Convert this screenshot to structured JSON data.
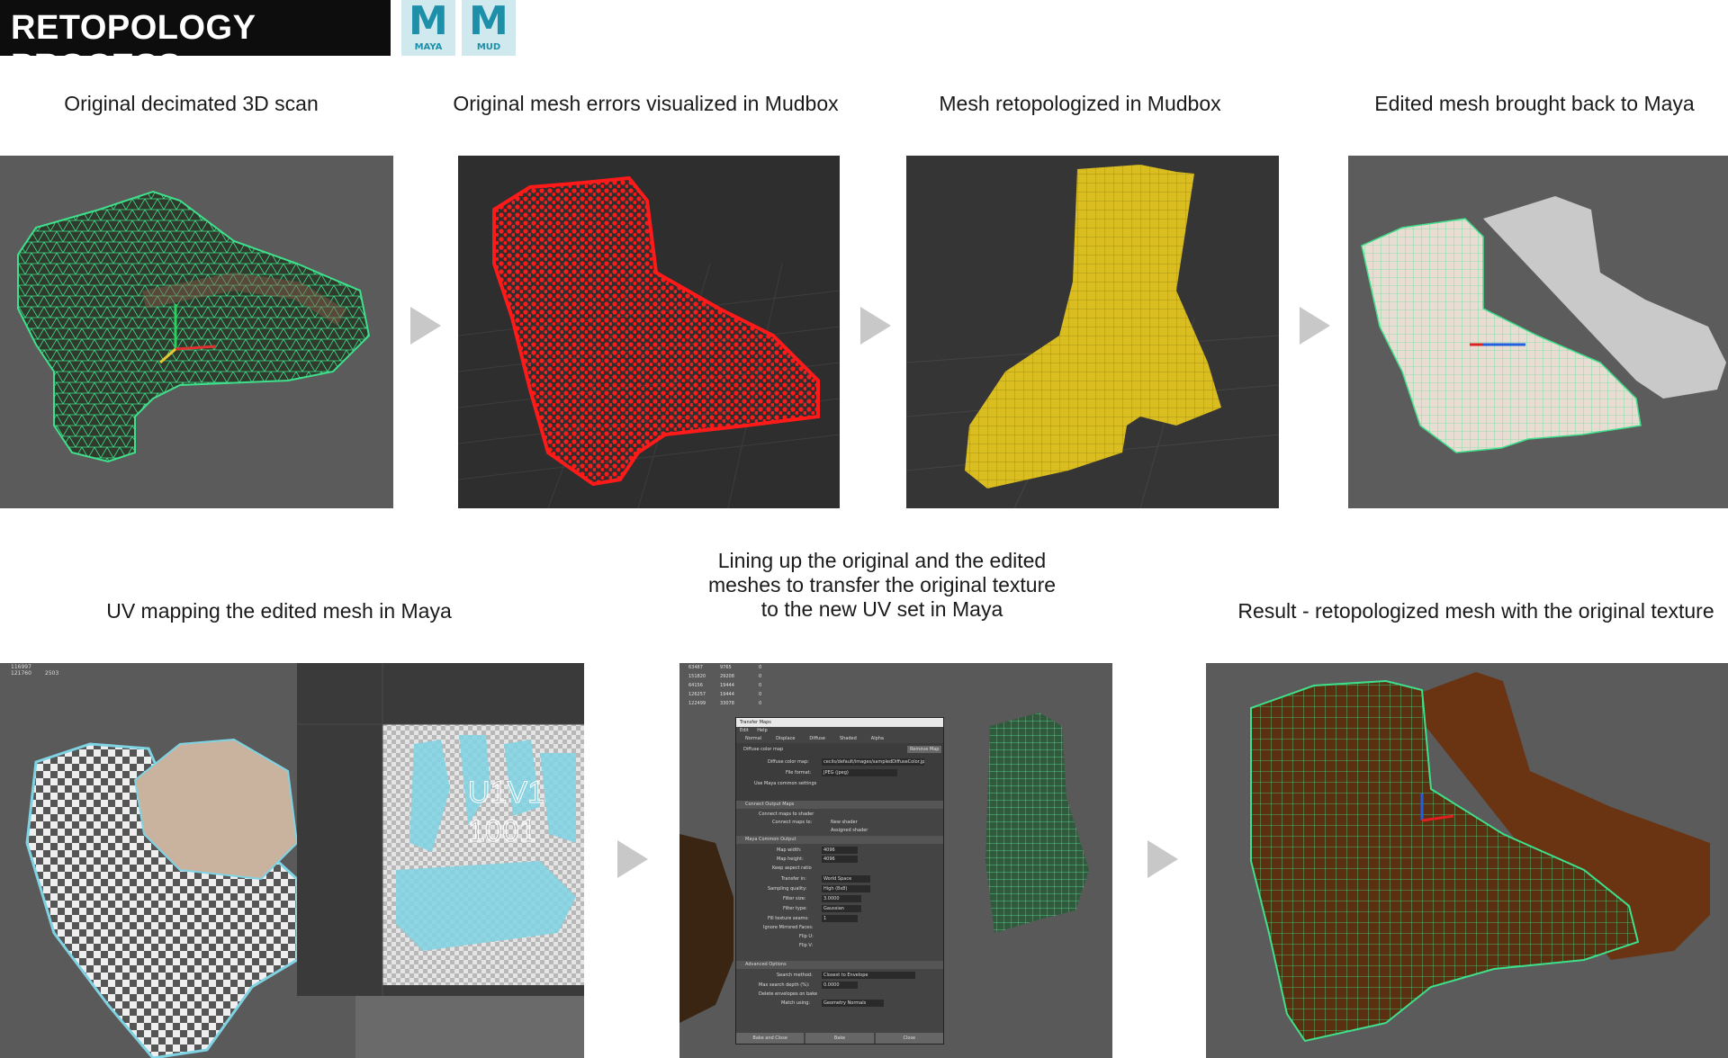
{
  "header": {
    "title": "RETOPOLOGY PROCESS",
    "logos": [
      {
        "icon": "maya-logo-icon",
        "label": "MAYA",
        "color": "#1e8fa8"
      },
      {
        "icon": "mudbox-logo-icon",
        "label": "MUD",
        "color": "#1e8fa8"
      }
    ]
  },
  "steps": [
    {
      "caption": "Original decimated 3D scan"
    },
    {
      "caption": "Original mesh errors visualized in Mudbox"
    },
    {
      "caption": "Mesh retopologized in Mudbox"
    },
    {
      "caption": "Edited mesh brought back to Maya"
    },
    {
      "caption": "UV mapping the edited mesh in Maya"
    },
    {
      "caption_lines": [
        "Lining up the original and the edited",
        "meshes to transfer the original texture",
        "to the new UV set in Maya"
      ]
    },
    {
      "caption": "Result - retopologized mesh with the original texture"
    }
  ],
  "uv_editor": {
    "tile_label_1": "U1V1",
    "tile_label_2": "1001",
    "stats": [
      "116997",
      "121760",
      "2503"
    ]
  },
  "transfer_maps": {
    "window_title": "Transfer Maps",
    "menu": [
      "Edit",
      "Help"
    ],
    "tabs": [
      "Normal",
      "Displace",
      "Diffuse",
      "Shaded",
      "Alpha"
    ],
    "diffuse_checkbox": "Diffuse color map",
    "remove_button": "Remove Map",
    "diffuse_map_label": "Diffuse color map:",
    "diffuse_map_value": "cecils/default/images/sampledDiffuseColor.jpg",
    "file_format_label": "File format:",
    "file_format_value": "JPEG (jpeg)",
    "use_common_label": "Use Maya common settings",
    "connect_section": "Connect Output Maps",
    "connect_shader_label": "Connect maps to shader",
    "connect_to_label": "Connect maps to:",
    "connect_option_1": "New shader",
    "connect_option_2": "Assigned shader",
    "common_section": "Maya Common Output",
    "map_width_label": "Map width:",
    "map_width_value": "4096",
    "map_height_label": "Map height:",
    "map_height_value": "4096",
    "keep_aspect_label": "Keep aspect ratio",
    "transfer_in_label": "Transfer in:",
    "transfer_in_value": "World Space",
    "sampling_label": "Sampling quality:",
    "sampling_value": "High (8x8)",
    "filter_size_label": "Filter size:",
    "filter_size_value": "3.0000",
    "filter_type_label": "Filter type:",
    "filter_type_value": "Gaussian",
    "fill_seams_label": "Fill texture seams:",
    "fill_seams_value": "1",
    "ignore_faces_label": "Ignore Mirrored Faces:",
    "flip_u_label": "Flip U:",
    "flip_v_label": "Flip V:",
    "advanced_section": "Advanced Options",
    "search_method_label": "Search method:",
    "search_method_value": "Closest to Envelope",
    "max_depth_label": "Max search depth (%):",
    "max_depth_value": "0.0000",
    "delete_env_label": "Delete envelopes on bake",
    "match_using_label": "Match using:",
    "match_using_value": "Geometry Normals",
    "btn_bake_close": "Bake and Close",
    "btn_bake": "Bake",
    "btn_close": "Close",
    "stats": [
      "63487",
      "9765",
      "0",
      "151820",
      "29208",
      "0",
      "64156",
      "19444",
      "0",
      "126257",
      "19444",
      "0",
      "122499",
      "33078",
      "0"
    ]
  },
  "colors": {
    "viewport_grey": "#5a5a5a",
    "mudbox_dark": "#2d2d2d",
    "wire_green": "#38e08a",
    "error_red": "#ff1a1a",
    "retopo_yellow": "#d9bd21",
    "uv_cyan": "#7fd3e3",
    "leather_brown": "#6a3413",
    "arrow_grey": "#c8c8c8"
  }
}
